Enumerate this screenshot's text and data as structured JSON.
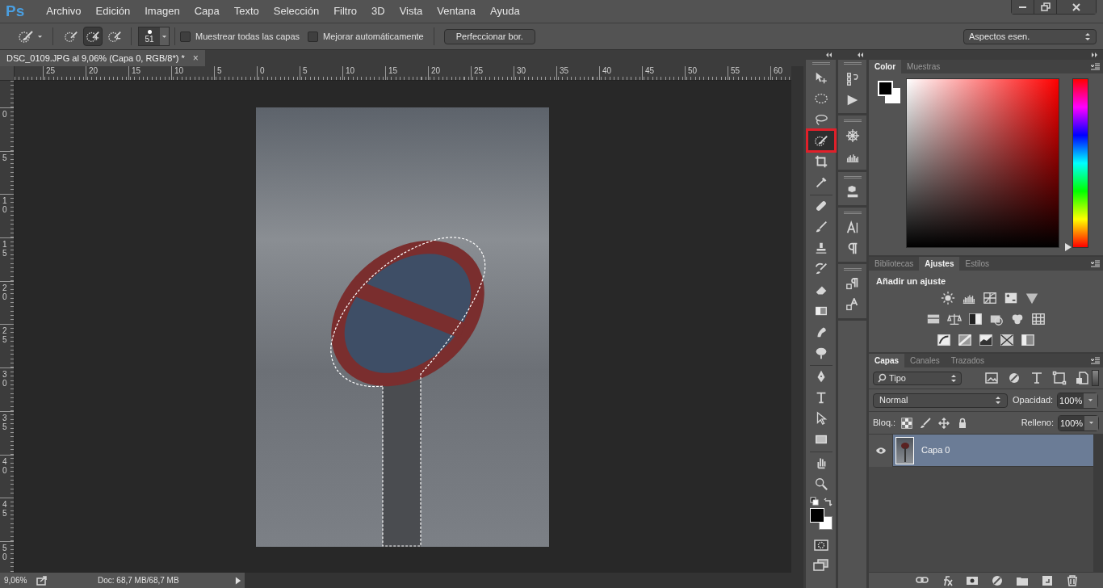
{
  "app_logo": "Ps",
  "menu": [
    "Archivo",
    "Edición",
    "Imagen",
    "Capa",
    "Texto",
    "Selección",
    "Filtro",
    "3D",
    "Vista",
    "Ventana",
    "Ayuda"
  ],
  "options_bar": {
    "modes": [
      {
        "selected": false
      },
      {
        "selected": true
      },
      {
        "selected": false
      }
    ],
    "brush_size": "51",
    "checkboxes": [
      {
        "label": "Muestrear todas las capas",
        "checked": false
      },
      {
        "label": "Mejorar automáticamente",
        "checked": false
      }
    ],
    "refine_button": "Perfeccionar bor.",
    "workspace": "Aspectos esen."
  },
  "document_tab": {
    "title": "DSC_0109.JPG al 9,06% (Capa 0, RGB/8*) *",
    "close": "×"
  },
  "rulers": {
    "horizontal": [
      "25",
      "20",
      "15",
      "10",
      "5",
      "0",
      "5",
      "10",
      "15",
      "20",
      "25",
      "30",
      "35",
      "40",
      "45",
      "50",
      "55",
      "60"
    ],
    "vertical": [
      "0",
      "5",
      "10",
      "15",
      "20",
      "25",
      "30",
      "35",
      "40",
      "45",
      "50"
    ]
  },
  "tools": [
    {
      "kind": "move",
      "selected": false
    },
    {
      "kind": "ellipse",
      "selected": false
    },
    {
      "kind": "lasso",
      "selected": false
    },
    {
      "kind": "quick_selection",
      "selected": true
    },
    {
      "kind": "crop",
      "selected": false
    },
    {
      "kind": "eyedropper",
      "selected": false
    },
    {
      "kind": "healing",
      "selected": false
    },
    {
      "kind": "brush",
      "selected": false
    },
    {
      "kind": "stamp",
      "selected": false
    },
    {
      "kind": "history_brush",
      "selected": false
    },
    {
      "kind": "eraser",
      "selected": false
    },
    {
      "kind": "gradient",
      "selected": false
    },
    {
      "kind": "blur",
      "selected": false
    },
    {
      "kind": "dodge",
      "selected": false
    },
    {
      "kind": "pen",
      "selected": false
    },
    {
      "kind": "type",
      "selected": false
    },
    {
      "kind": "path_selection",
      "selected": false
    },
    {
      "kind": "rectangle",
      "selected": false
    },
    {
      "kind": "hand",
      "selected": false
    },
    {
      "kind": "zoom",
      "selected": false
    }
  ],
  "color_panel": {
    "tabs": [
      {
        "label": "Color",
        "selected": true
      },
      {
        "label": "Muestras",
        "selected": false
      }
    ],
    "hue_slider": {
      "level": 0
    }
  },
  "adjustments_panel": {
    "tabs": [
      {
        "label": "Bibliotecas",
        "selected": false
      },
      {
        "label": "Ajustes",
        "selected": true
      },
      {
        "label": "Estilos",
        "selected": false
      }
    ],
    "heading": "Añadir un ajuste"
  },
  "layers_panel": {
    "tabs": [
      {
        "label": "Capas",
        "selected": true
      },
      {
        "label": "Canales",
        "selected": false
      },
      {
        "label": "Trazados",
        "selected": false
      }
    ],
    "filter": "Tipo",
    "blend_mode": "Normal",
    "opacity_label": "Opacidad:",
    "opacity": "100%",
    "lock_label": "Bloq.:",
    "fill_label": "Relleno:",
    "fill": "100%",
    "layers": [
      {
        "name": "Capa 0",
        "visible": true,
        "selected": true
      }
    ]
  },
  "status_bar": {
    "zoom": "9,06%",
    "doc_info": "Doc: 68,7 MB/68,7 MB"
  }
}
